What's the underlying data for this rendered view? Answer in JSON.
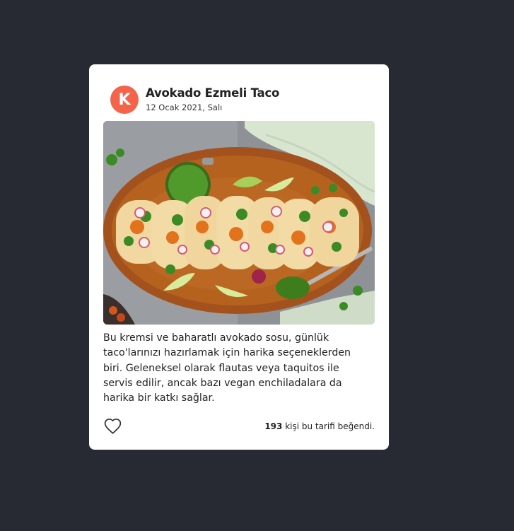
{
  "post": {
    "avatar_letter": "K",
    "title": "Avokado Ezmeli Taco",
    "date": "12 Ocak 2021, Salı",
    "image_alt": "",
    "description": "Bu kremsi ve baharatlı avokado sosu, günlük taco'larınızı hazırlamak için harika seçeneklerden biri. Geleneksel olarak flautas veya taquitos ile servis edilir, ancak bazı vegan enchiladalara da harika bir katkı sağlar.",
    "like_count": "193",
    "like_text": " kişi bu tarifi beğendi."
  },
  "icons": {
    "like": "heart-outline-icon"
  },
  "colors": {
    "background": "#272a33",
    "card": "#ffffff",
    "avatar": "#f3644a"
  }
}
